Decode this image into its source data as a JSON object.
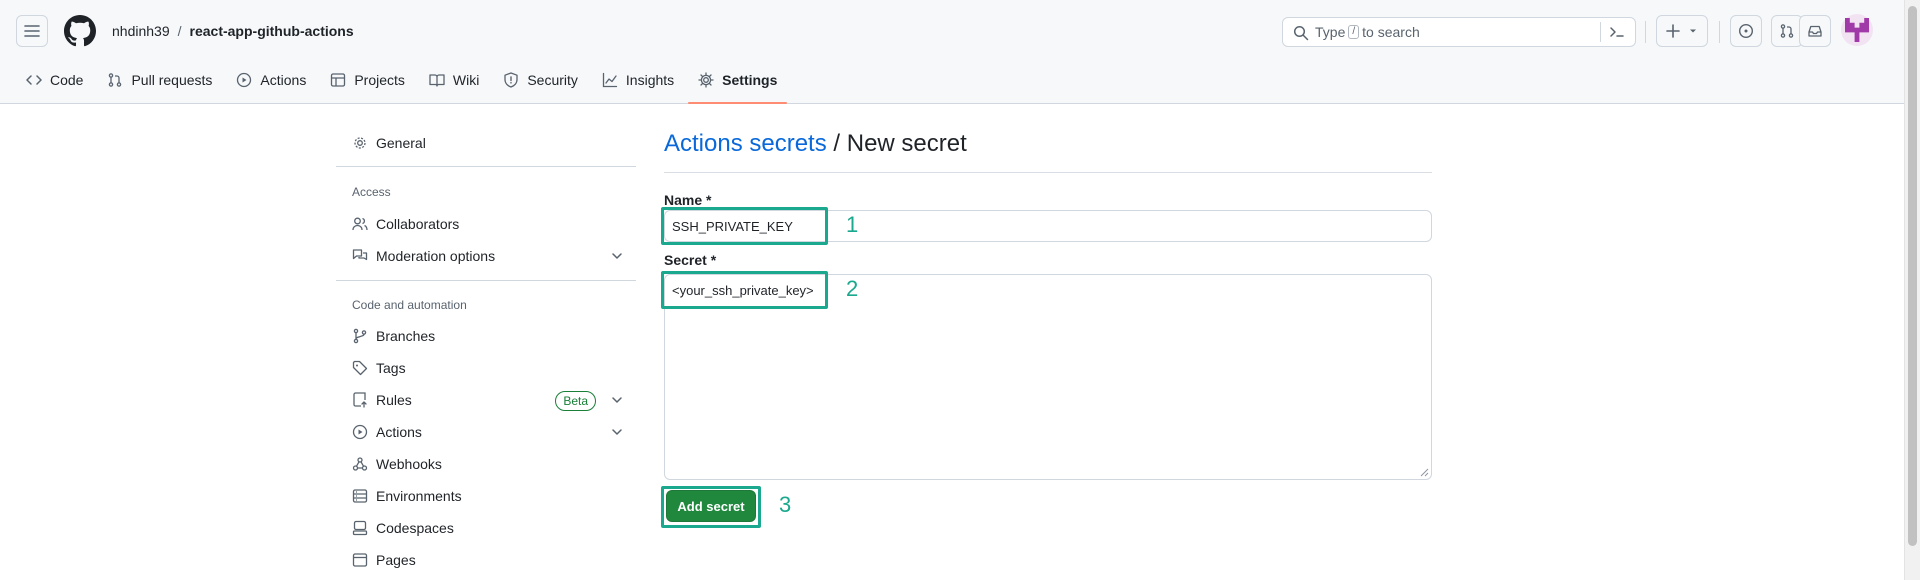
{
  "header": {
    "owner": "nhdinh39",
    "separator": "/",
    "repo": "react-app-github-actions",
    "search_placeholder_prefix": "Type",
    "search_slash": "/",
    "search_placeholder_suffix": "to search"
  },
  "tabs": [
    {
      "label": "Code",
      "icon": "code-icon"
    },
    {
      "label": "Pull requests",
      "icon": "pull-request-icon"
    },
    {
      "label": "Actions",
      "icon": "play-icon"
    },
    {
      "label": "Projects",
      "icon": "table-icon"
    },
    {
      "label": "Wiki",
      "icon": "book-icon"
    },
    {
      "label": "Security",
      "icon": "shield-icon"
    },
    {
      "label": "Insights",
      "icon": "graph-icon"
    },
    {
      "label": "Settings",
      "icon": "gear-icon",
      "active": true
    }
  ],
  "sidebar": {
    "general": "General",
    "access_heading": "Access",
    "collaborators": "Collaborators",
    "moderation": "Moderation options",
    "code_heading": "Code and automation",
    "branches": "Branches",
    "tags": "Tags",
    "rules": "Rules",
    "beta": "Beta",
    "actions": "Actions",
    "webhooks": "Webhooks",
    "environments": "Environments",
    "codespaces": "Codespaces",
    "pages": "Pages"
  },
  "main": {
    "title_link": "Actions secrets",
    "title_rest": " / New secret",
    "name_label": "Name *",
    "name_value": "SSH_PRIVATE_KEY",
    "secret_label": "Secret *",
    "secret_value": "<your_ssh_private_key>",
    "add_button": "Add secret"
  },
  "annotations": {
    "step1": "1",
    "step2": "2",
    "step3": "3",
    "color": "#1aa88e"
  },
  "colors": {
    "accent_link": "#0969da",
    "primary_button": "#1f883d",
    "active_tab_underline": "#fd8c73"
  }
}
